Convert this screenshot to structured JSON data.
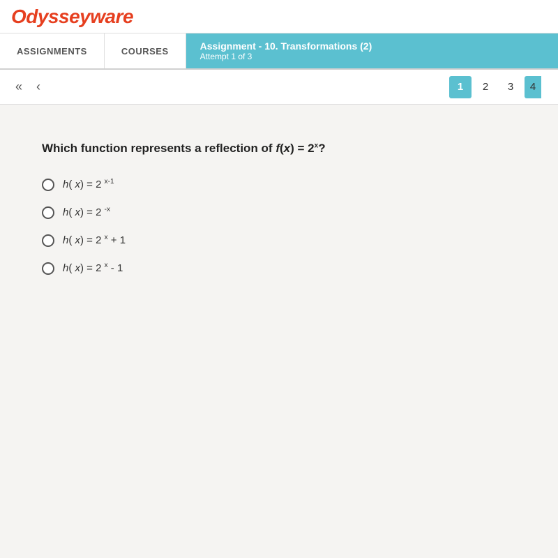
{
  "logo": {
    "text": "Odysseyware"
  },
  "nav": {
    "assignments_label": "ASSIGNMENTS",
    "courses_label": "COURSES",
    "assignment_title": "Assignment  - 10. Transformations (2)",
    "attempt_text": "Attempt 1 of 3"
  },
  "pagination": {
    "double_left_arrow": "«",
    "single_left_arrow": "‹",
    "pages": [
      "1",
      "2",
      "3",
      "4"
    ],
    "active_page": "1"
  },
  "question": {
    "text": "Which function represents a reflection of f(x) = 2",
    "superscript": "x",
    "text_suffix": "?",
    "options": [
      {
        "id": "opt1",
        "base_label": "h( x) = 2",
        "superscript": "x-1"
      },
      {
        "id": "opt2",
        "base_label": "h( x) = 2",
        "superscript": "-x"
      },
      {
        "id": "opt3",
        "base_label": "h( x) = 2",
        "superscript": "x",
        "suffix": " + 1"
      },
      {
        "id": "opt4",
        "base_label": "h( x) = 2",
        "superscript": "x",
        "suffix": " - 1"
      }
    ]
  }
}
